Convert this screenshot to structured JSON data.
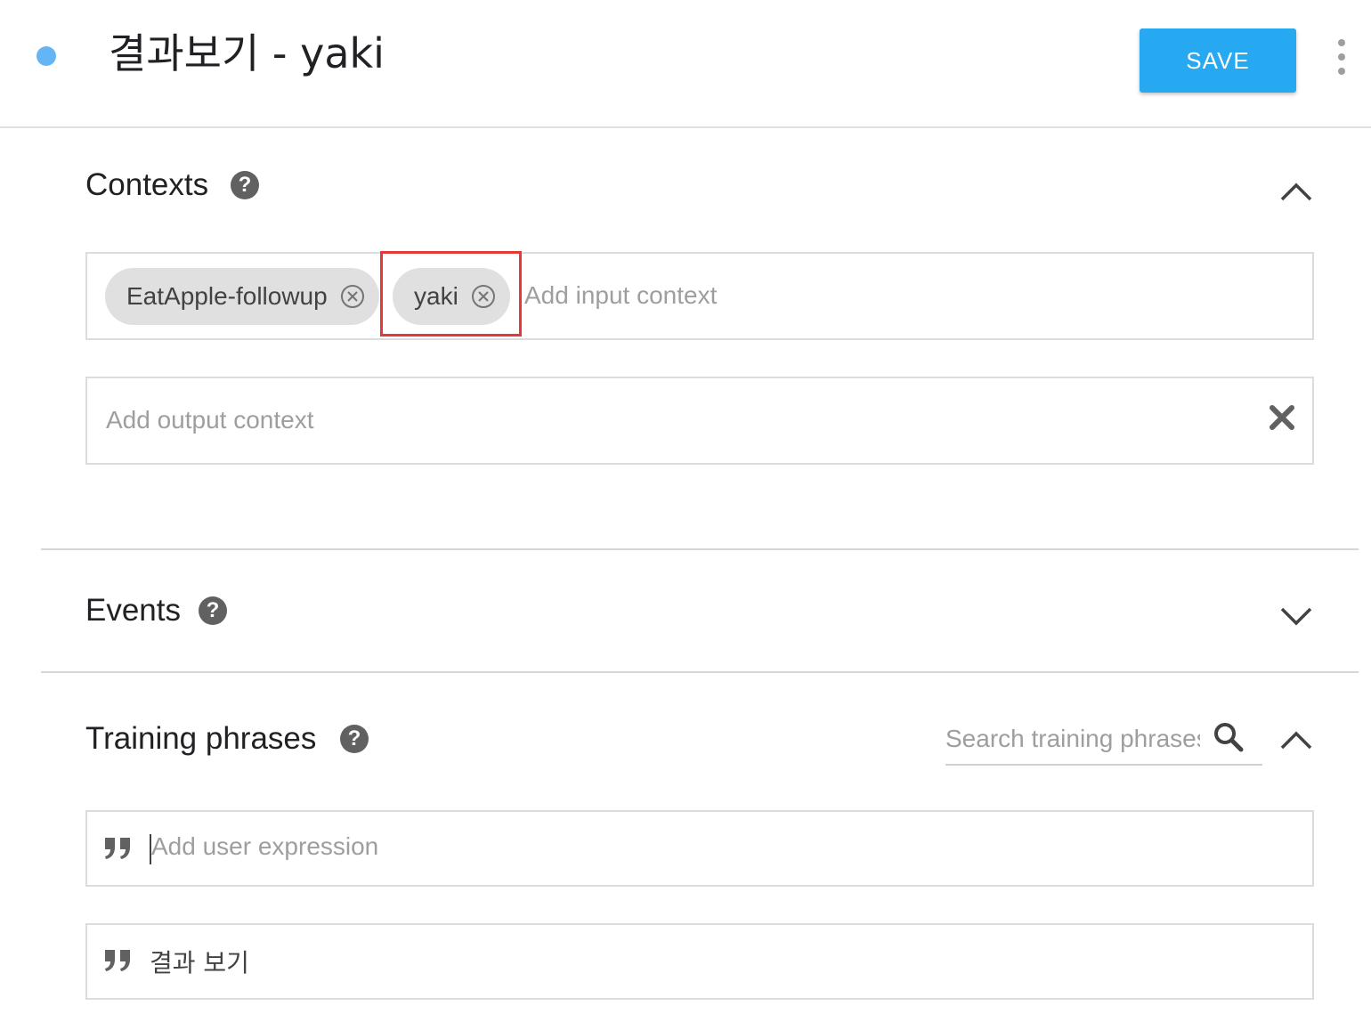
{
  "header": {
    "title": "결과보기 - yaki",
    "save_label": "SAVE",
    "status_color": "#64b5f6",
    "accent_color": "#26a9f0"
  },
  "contexts": {
    "title": "Contexts",
    "help": "?",
    "input_chips": [
      "EatApple-followup",
      "yaki"
    ],
    "input_placeholder": "Add input context",
    "output_placeholder": "Add output context",
    "highlight_color": "#e53935",
    "collapse_icon": "chevron-up-icon",
    "clear_icon": "close-icon"
  },
  "events": {
    "title": "Events",
    "help": "?",
    "expand_icon": "chevron-down-icon"
  },
  "training": {
    "title": "Training phrases",
    "help": "?",
    "search_placeholder": "Search training phrases",
    "add_placeholder": "Add user expression",
    "phrases": [
      "결과 보기"
    ],
    "collapse_icon": "chevron-up-icon",
    "search_icon": "search-icon",
    "quote_icon": "quote-icon"
  }
}
